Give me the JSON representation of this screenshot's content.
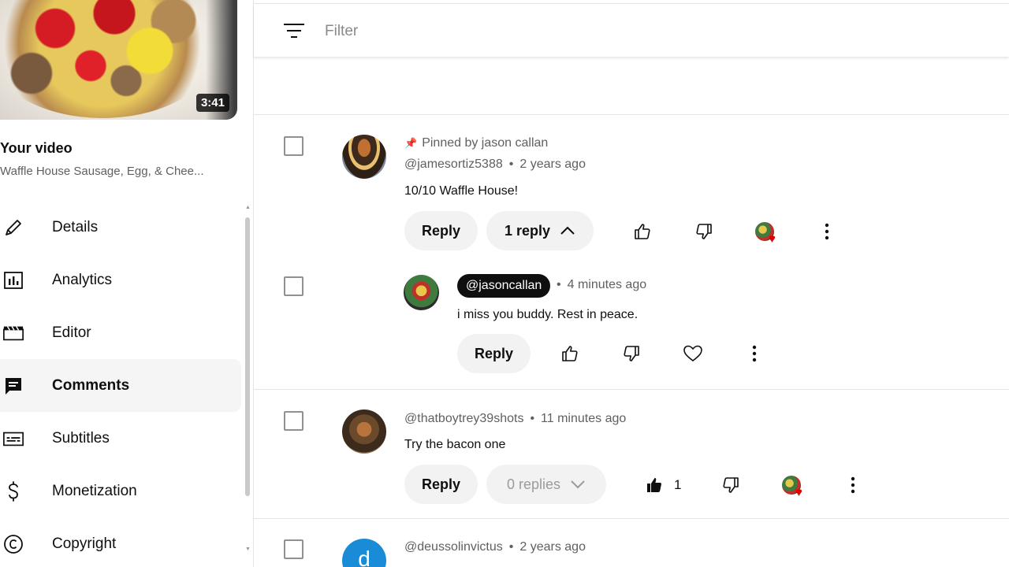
{
  "sidebar": {
    "thumbnail": {
      "duration": "3:41"
    },
    "your_video_label": "Your video",
    "video_title": "Waffle House Sausage, Egg, & Chee...",
    "items": [
      {
        "label": "Details",
        "icon": "pencil-icon",
        "active": false
      },
      {
        "label": "Analytics",
        "icon": "analytics-icon",
        "active": false
      },
      {
        "label": "Editor",
        "icon": "clapperboard-icon",
        "active": false
      },
      {
        "label": "Comments",
        "icon": "comment-icon",
        "active": true
      },
      {
        "label": "Subtitles",
        "icon": "subtitles-icon",
        "active": false
      },
      {
        "label": "Monetization",
        "icon": "dollar-icon",
        "active": false
      },
      {
        "label": "Copyright",
        "icon": "copyright-icon",
        "active": false
      }
    ]
  },
  "filter": {
    "placeholder": "Filter"
  },
  "comments": [
    {
      "pinned_label": "Pinned by jason callan",
      "author": "@jamesortiz5388",
      "time": "2 years ago",
      "text": "10/10 Waffle House!",
      "reply_label": "Reply",
      "replies_label": "1 reply",
      "creator_heart": true
    },
    {
      "author": "@jasoncallan",
      "time": "4 minutes ago",
      "text": "i miss you buddy. Rest in peace.",
      "reply_label": "Reply"
    },
    {
      "author": "@thatboytrey39shots",
      "time": "11 minutes ago",
      "text": "Try the bacon one",
      "reply_label": "Reply",
      "replies_label": "0 replies",
      "like_count": "1",
      "creator_heart": true
    },
    {
      "author": "@deussolinvictus",
      "time": "2 years ago",
      "avatar_letter": "d"
    }
  ],
  "colors": {
    "accent_dark": "#0f0f0f",
    "heart": "#e00000",
    "avatar_blue": "#1a8bd6"
  }
}
